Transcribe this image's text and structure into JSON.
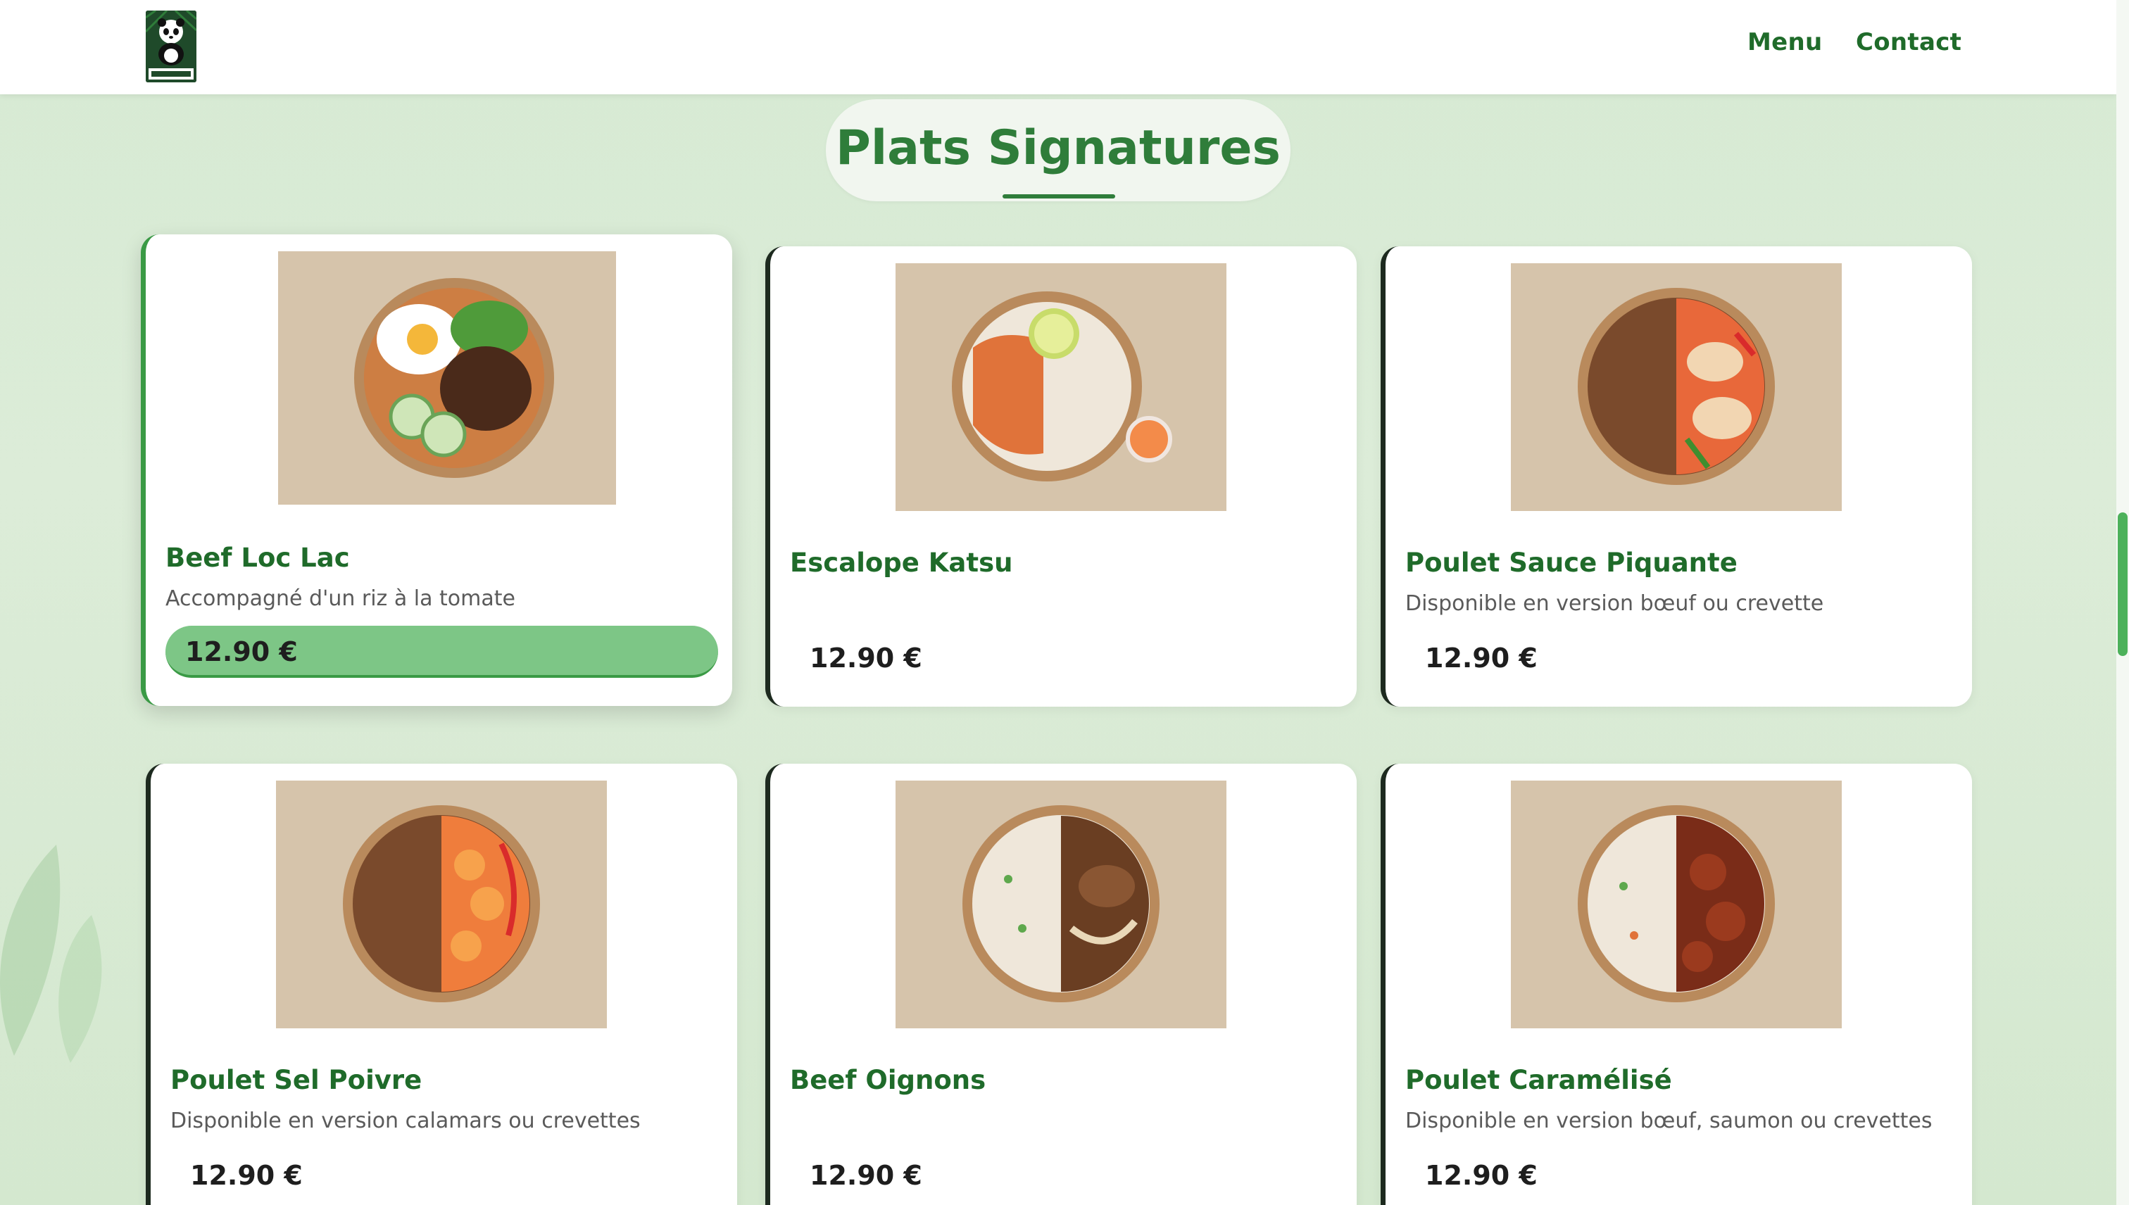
{
  "header": {
    "logo_alt": "DAREWOK",
    "nav": [
      {
        "label": "Menu"
      },
      {
        "label": "Contact"
      }
    ]
  },
  "section": {
    "title": "Plats Signatures"
  },
  "dishes": [
    {
      "name": "Beef Loc Lac",
      "description": "Accompagné d'un riz à la tomate",
      "price": "12.90 €",
      "featured": true
    },
    {
      "name": "Escalope Katsu",
      "description": "",
      "price": "12.90 €",
      "featured": false
    },
    {
      "name": "Poulet Sauce Piquante",
      "description": "Disponible en version bœuf ou crevette",
      "price": "12.90 €",
      "featured": false
    },
    {
      "name": "Poulet Sel Poivre",
      "description": "Disponible en version calamars ou crevettes",
      "price": "12.90 €",
      "featured": false
    },
    {
      "name": "Beef Oignons",
      "description": "",
      "price": "12.90 €",
      "featured": false
    },
    {
      "name": "Poulet Caramélisé",
      "description": "Disponible en version bœuf, saumon ou crevettes",
      "price": "12.90 €",
      "featured": false
    }
  ],
  "colors": {
    "brand_green": "#2f7d3a",
    "dish_name_green": "#1f6b2a",
    "price_highlight": "#7dc686",
    "background": "#d6ead3"
  }
}
